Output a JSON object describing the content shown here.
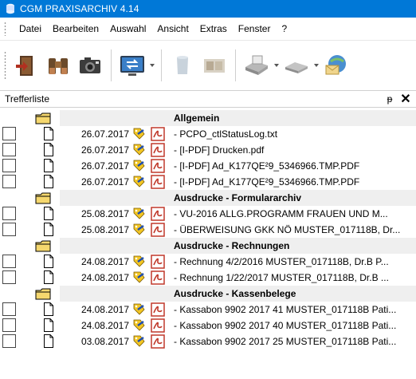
{
  "window": {
    "title": "CGM PRAXISARCHIV 4.14"
  },
  "menu": [
    "Datei",
    "Bearbeiten",
    "Auswahl",
    "Ansicht",
    "Extras",
    "Fenster",
    "?"
  ],
  "toolbar": {
    "buttons": [
      "door-exit-icon",
      "binoculars-icon",
      "camera-icon",
      "transfer-screen-icon",
      "bin-icon",
      "scanner-photo-icon",
      "scanner-icon",
      "device-icon",
      "globe-mail-icon"
    ]
  },
  "panel": {
    "title": "Trefferliste",
    "pin_icon": "pin-icon",
    "close_icon": "close-icon"
  },
  "groups": [
    {
      "title": "Allgemein",
      "items": [
        {
          "date": "26.07.2017",
          "title": "- PCPO_ctlStatusLog.txt"
        },
        {
          "date": "26.07.2017",
          "title": "- [I-PDF] Drucken.pdf"
        },
        {
          "date": "26.07.2017",
          "title": "- [I-PDF] Ad_K177QE²9_5346966.TMP.PDF"
        },
        {
          "date": "26.07.2017",
          "title": "- [I-PDF] Ad_K177QE²9_5346966.TMP.PDF"
        }
      ]
    },
    {
      "title": "Ausdrucke - Formulararchiv",
      "items": [
        {
          "date": "25.08.2017",
          "title": "- VU-2016 ALLG.PROGRAMM FRAUEN UND M..."
        },
        {
          "date": "25.08.2017",
          "title": "- ÜBERWEISUNG GKK NÖ MUSTER_017118B, Dr..."
        }
      ]
    },
    {
      "title": "Ausdrucke - Rechnungen",
      "items": [
        {
          "date": "24.08.2017",
          "title": "- Rechnung 4/2/2016 MUSTER_017118B, Dr.B P..."
        },
        {
          "date": "24.08.2017",
          "title": "- Rechnung 1/22/2017 MUSTER_017118B, Dr.B ..."
        }
      ]
    },
    {
      "title": "Ausdrucke - Kassenbelege",
      "items": [
        {
          "date": "24.08.2017",
          "title": "- Kassabon 9902 2017 41 MUSTER_017118B Pati..."
        },
        {
          "date": "24.08.2017",
          "title": "- Kassabon 9902 2017 40 MUSTER_017118B Pati..."
        },
        {
          "date": "03.08.2017",
          "title": "- Kassabon 9902 2017 25 MUSTER_017118B Pati..."
        }
      ]
    }
  ]
}
